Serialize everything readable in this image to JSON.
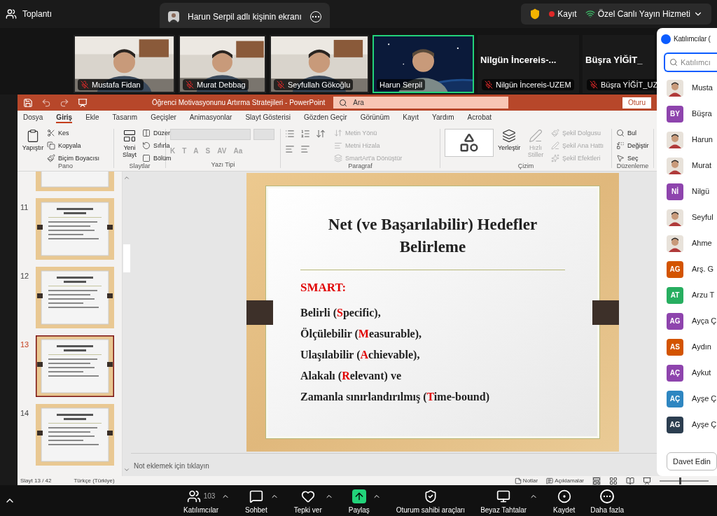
{
  "top_bar": {
    "title": "Toplantı",
    "share_tab": {
      "label": "Harun Serpil adlı kişinin ekranı"
    },
    "recording": {
      "label": "Kayıt"
    },
    "live_stream": {
      "label": "Özel Canlı Yayın Hizmeti"
    }
  },
  "video_tiles": [
    {
      "kind": "video",
      "name": "Mustafa Fidan",
      "muted": true,
      "speaking": false
    },
    {
      "kind": "video",
      "name": "Murat Debbag",
      "muted": true,
      "speaking": false
    },
    {
      "kind": "video",
      "name": "Seyfullah Gökoğlu",
      "muted": true,
      "speaking": false
    },
    {
      "kind": "video",
      "name": "Harun Serpil",
      "muted": false,
      "speaking": true
    },
    {
      "kind": "name",
      "display": "Nilgün İncereis-...",
      "name": "Nilgün İncereis-UZEM",
      "muted": true,
      "speaking": false
    },
    {
      "kind": "name",
      "display": "Büşra YİĞİT_",
      "name": "Büşra YİĞİT_UZ",
      "muted": true,
      "speaking": false
    }
  ],
  "powerpoint": {
    "title": "Öğrenci Motivasyonunu Artırma Stratejileri  -  PowerPoint",
    "search": {
      "placeholder": "Ara"
    },
    "share_button": "Oturu",
    "tabs": [
      {
        "label": "Dosya",
        "selected": false
      },
      {
        "label": "Giriş",
        "selected": true
      },
      {
        "label": "Ekle",
        "selected": false
      },
      {
        "label": "Tasarım",
        "selected": false
      },
      {
        "label": "Geçişler",
        "selected": false
      },
      {
        "label": "Animasyonlar",
        "selected": false
      },
      {
        "label": "Slayt Gösterisi",
        "selected": false
      },
      {
        "label": "Gözden Geçir",
        "selected": false
      },
      {
        "label": "Görünüm",
        "selected": false
      },
      {
        "label": "Kayıt",
        "selected": false
      },
      {
        "label": "Yardım",
        "selected": false
      },
      {
        "label": "Acrobat",
        "selected": false
      }
    ],
    "ribbon": [
      {
        "kind": "clipboard",
        "title": "Pano",
        "items": [
          {
            "label": "Yapıştır",
            "disabled": false
          },
          {
            "label": "Kes",
            "disabled": false
          },
          {
            "label": "Kopyala",
            "disabled": false
          },
          {
            "label": "Biçim Boyacısı",
            "disabled": false
          }
        ]
      },
      {
        "kind": "slides",
        "title": "Slaytlar",
        "items": [
          {
            "label": "Yeni Slayt",
            "disabled": false
          },
          {
            "label": "Düzen",
            "disabled": false
          },
          {
            "label": "Sıfırla",
            "disabled": false
          },
          {
            "label": "Bölüm",
            "disabled": false
          }
        ]
      },
      {
        "kind": "font",
        "title": "Yazı Tipi",
        "items": [
          {
            "label": "K",
            "disabled": true
          },
          {
            "label": "T",
            "disabled": true
          },
          {
            "label": "A",
            "disabled": true
          },
          {
            "label": "S",
            "disabled": true
          },
          {
            "label": "AV",
            "disabled": true
          },
          {
            "label": "Aa",
            "disabled": true
          }
        ]
      },
      {
        "kind": "paragraph",
        "title": "Paragraf",
        "items": [
          {
            "label": "Metin Yönü",
            "disabled": true
          },
          {
            "label": "Metni Hizala",
            "disabled": true
          },
          {
            "label": "SmartArt'a Dönüştür",
            "disabled": true
          }
        ]
      },
      {
        "kind": "drawing",
        "title": "Çizim",
        "items": [
          {
            "label": "Yerleştir",
            "disabled": false
          },
          {
            "label": "Hızlı Stiller",
            "disabled": true
          },
          {
            "label": "Şekil Dolgusu",
            "disabled": true
          },
          {
            "label": "Şekil Ana Hattı",
            "disabled": true
          },
          {
            "label": "Şekil Efektleri",
            "disabled": true
          }
        ]
      },
      {
        "kind": "editing",
        "title": "Düzenleme",
        "items": [
          {
            "label": "Bul",
            "disabled": false
          },
          {
            "label": "Değiştir",
            "disabled": false
          },
          {
            "label": "Seç",
            "disabled": false
          }
        ]
      }
    ],
    "thumbnails": [
      {
        "selected": false
      },
      {
        "number": "11",
        "selected": false
      },
      {
        "number": "12",
        "selected": false
      },
      {
        "number": "13",
        "selected": true
      },
      {
        "number": "14",
        "selected": false
      }
    ],
    "slide": {
      "title": "Net (ve Başarılabilir) Hedefler Belirleme",
      "heading": "SMART:",
      "lines": [
        {
          "before": "Belirli (",
          "letter": "S",
          "after": "pecific),"
        },
        {
          "before": "Ölçülebilir (",
          "letter": "M",
          "after": "easurable),"
        },
        {
          "before": "Ulaşılabilir (",
          "letter": "A",
          "after": "chievable),"
        },
        {
          "before": "Alakalı (",
          "letter": "R",
          "after": "elevant) ve"
        },
        {
          "before": "Zamanla sınırlandırılmış (",
          "letter": "T",
          "after": "ime-bound)"
        }
      ]
    },
    "notes": {
      "placeholder": "Not eklemek için tıklayın"
    },
    "status_bar": {
      "slide": "Slayt 13 / 42",
      "language": "Türkçe (Türkiye)",
      "notes": "Notlar",
      "comments": "Açıklamalar",
      "zoom": {
        "level": 0.4
      }
    }
  },
  "participants": {
    "title": "Katılımcılar (",
    "search": {
      "placeholder": "Katılımcı"
    },
    "items": [
      {
        "name": "Musta"
      },
      {
        "kind": "initials",
        "initials": "BY",
        "color": "#8e44ad",
        "name": "Büşra"
      },
      {
        "name": "Harun"
      },
      {
        "name": "Murat"
      },
      {
        "kind": "initials",
        "initials": "Nİ",
        "color": "#8e44ad",
        "name": "Nilgü"
      },
      {
        "name": "Seyful"
      },
      {
        "name": "Ahme"
      },
      {
        "kind": "initials",
        "initials": "AG",
        "color": "#d35400",
        "name": "Arş. G"
      },
      {
        "kind": "initials",
        "initials": "AT",
        "color": "#27ae60",
        "name": "Arzu T"
      },
      {
        "kind": "initials",
        "initials": "AG",
        "color": "#8e44ad",
        "name": "Ayça Ç"
      },
      {
        "kind": "initials",
        "initials": "AS",
        "color": "#d35400",
        "name": "Aydın"
      },
      {
        "kind": "initials",
        "initials": "AÇ",
        "color": "#8e44ad",
        "name": "Aykut"
      },
      {
        "kind": "initials",
        "initials": "AÇ",
        "color": "#2e86c1",
        "name": "Ayşe Ç"
      },
      {
        "kind": "initials",
        "initials": "AG",
        "color": "#2c3e50",
        "name": "Ayşe Ç"
      }
    ],
    "invite_button": "Davet Edin"
  },
  "toolbar": [
    {
      "kind": "participants",
      "label": "Katılımcılar",
      "count": "103",
      "caret": true
    },
    {
      "kind": "chat",
      "label": "Sohbet",
      "caret": true
    },
    {
      "kind": "react",
      "label": "Tepki ver",
      "caret": true
    },
    {
      "kind": "share",
      "label": "Paylaş",
      "caret": true
    },
    {
      "kind": "host",
      "label": "Oturum sahibi araçları",
      "caret": false
    },
    {
      "kind": "whiteboard",
      "label": "Beyaz Tahtalar",
      "caret": true
    },
    {
      "kind": "record",
      "label": "Kaydet",
      "caret": false
    },
    {
      "kind": "more",
      "label": "Daha fazla",
      "caret": false
    }
  ]
}
